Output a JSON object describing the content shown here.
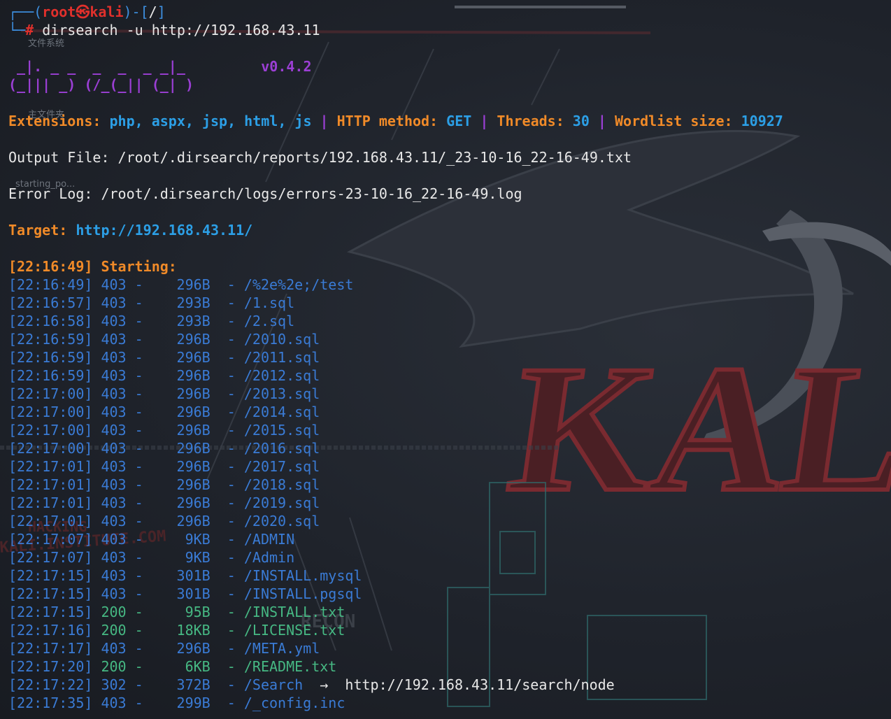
{
  "prompt": {
    "user": "root",
    "host": "kali",
    "skull_glyph": "㉿",
    "cwd": "/",
    "command": "dirsearch -u http://192.168.43.11"
  },
  "banner": {
    "art_line1": " _|. _ _  _  _  _ _|_",
    "art_line2": "(_||| _) (/_(_|| (_| )",
    "version": "v0.4.2"
  },
  "config": {
    "extensions_label": "Extensions:",
    "extensions_value": "php, aspx, jsp, html, js",
    "method_label": "HTTP method:",
    "method_value": "GET",
    "threads_label": "Threads:",
    "threads_value": "30",
    "wordlist_label": "Wordlist size:",
    "wordlist_value": "10927"
  },
  "output_file": {
    "label": "Output File:",
    "path": "/root/.dirsearch/reports/192.168.43.11/_23-10-16_22-16-49.txt"
  },
  "error_log": {
    "label": "Error Log:",
    "path": "/root/.dirsearch/logs/errors-23-10-16_22-16-49.log"
  },
  "target": {
    "label": "Target:",
    "url": "http://192.168.43.11/"
  },
  "starting": {
    "time": "[22:16:49]",
    "label": "Starting:"
  },
  "results": [
    {
      "time": "[22:16:49]",
      "status": "403",
      "size": "296B",
      "path": "/%2e%2e;/test"
    },
    {
      "time": "[22:16:57]",
      "status": "403",
      "size": "293B",
      "path": "/1.sql"
    },
    {
      "time": "[22:16:58]",
      "status": "403",
      "size": "293B",
      "path": "/2.sql"
    },
    {
      "time": "[22:16:59]",
      "status": "403",
      "size": "296B",
      "path": "/2010.sql"
    },
    {
      "time": "[22:16:59]",
      "status": "403",
      "size": "296B",
      "path": "/2011.sql"
    },
    {
      "time": "[22:16:59]",
      "status": "403",
      "size": "296B",
      "path": "/2012.sql"
    },
    {
      "time": "[22:17:00]",
      "status": "403",
      "size": "296B",
      "path": "/2013.sql"
    },
    {
      "time": "[22:17:00]",
      "status": "403",
      "size": "296B",
      "path": "/2014.sql"
    },
    {
      "time": "[22:17:00]",
      "status": "403",
      "size": "296B",
      "path": "/2015.sql"
    },
    {
      "time": "[22:17:00]",
      "status": "403",
      "size": "296B",
      "path": "/2016.sql"
    },
    {
      "time": "[22:17:01]",
      "status": "403",
      "size": "296B",
      "path": "/2017.sql"
    },
    {
      "time": "[22:17:01]",
      "status": "403",
      "size": "296B",
      "path": "/2018.sql"
    },
    {
      "time": "[22:17:01]",
      "status": "403",
      "size": "296B",
      "path": "/2019.sql"
    },
    {
      "time": "[22:17:01]",
      "status": "403",
      "size": "296B",
      "path": "/2020.sql"
    },
    {
      "time": "[22:17:07]",
      "status": "403",
      "size": "9KB",
      "path": "/ADMIN"
    },
    {
      "time": "[22:17:07]",
      "status": "403",
      "size": "9KB",
      "path": "/Admin"
    },
    {
      "time": "[22:17:15]",
      "status": "403",
      "size": "301B",
      "path": "/INSTALL.mysql"
    },
    {
      "time": "[22:17:15]",
      "status": "403",
      "size": "301B",
      "path": "/INSTALL.pgsql"
    },
    {
      "time": "[22:17:15]",
      "status": "200",
      "size": "95B",
      "path": "/INSTALL.txt"
    },
    {
      "time": "[22:17:16]",
      "status": "200",
      "size": "18KB",
      "path": "/LICENSE.txt"
    },
    {
      "time": "[22:17:17]",
      "status": "403",
      "size": "296B",
      "path": "/META.yml"
    },
    {
      "time": "[22:17:20]",
      "status": "200",
      "size": "6KB",
      "path": "/README.txt"
    },
    {
      "time": "[22:17:22]",
      "status": "302",
      "size": "372B",
      "path": "/Search",
      "redirect": "http://192.168.43.11/search/node"
    },
    {
      "time": "[22:17:35]",
      "status": "403",
      "size": "299B",
      "path": "/_config.inc"
    }
  ],
  "desktop_labels": {
    "filesystem": "文件系统",
    "home": "主文件夹",
    "starting_po": "starting_po..."
  },
  "wallpaper_text": {
    "kali": "KALI",
    "recon": "RECON",
    "hacking": "HACKING",
    "kali_com": "KALI.INSTITUTE.COM"
  },
  "colors": {
    "bg": "#1f232b",
    "prompt_blue": "#3d8fe0",
    "prompt_red": "#e0302c",
    "orange": "#f08a28",
    "cyan": "#2c9fe6",
    "purple": "#9b3fd4",
    "log_blue": "#3a7bd5",
    "ok_green": "#46b883"
  }
}
